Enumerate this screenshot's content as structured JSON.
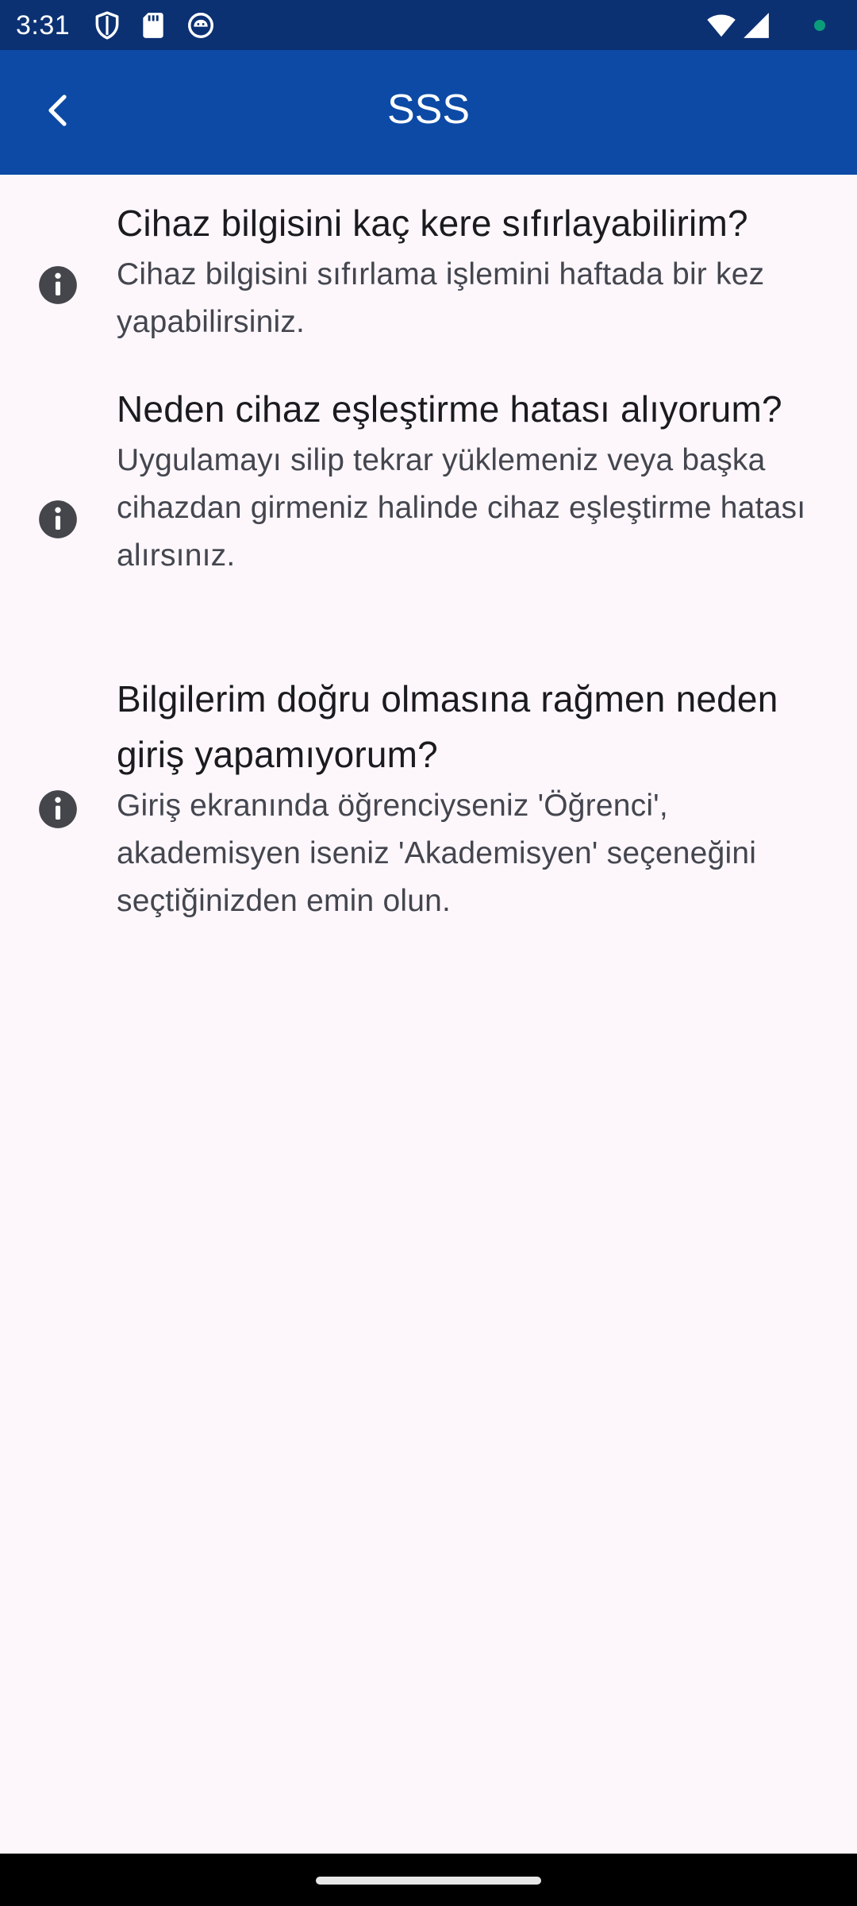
{
  "status_bar": {
    "time": "3:31",
    "icons": [
      "shield-icon",
      "sd-card-icon",
      "android-face-icon",
      "wifi-icon",
      "cell-signal-icon",
      "notification-dot-icon"
    ],
    "notification_dot_color": "#0b9c7a"
  },
  "app_bar": {
    "title": "SSS",
    "back_icon": "chevron-left-icon",
    "background": "#0c4aa6"
  },
  "faq": [
    {
      "icon": "info-icon",
      "question": "Cihaz bilgisini kaç kere sıfırlayabilirim?",
      "answer": "Cihaz bilgisini sıfırlama işlemini haftada bir kez yapabilirsiniz."
    },
    {
      "icon": "info-icon",
      "question": "Neden cihaz eşleştirme hatası alıyorum?",
      "answer": "Uygulamayı silip tekrar yüklemeniz veya başka cihazdan girmeniz halinde cihaz eşleştirme hatası alırsınız."
    },
    {
      "icon": "info-icon",
      "question": "Bilgilerim doğru olmasına rağmen neden giriş yapamıyorum?",
      "answer": "Giriş ekranında öğrenciyseniz 'Öğrenci', akademisyen iseniz 'Akademisyen' seçeneğini seçtiğinizden emin olun."
    }
  ]
}
